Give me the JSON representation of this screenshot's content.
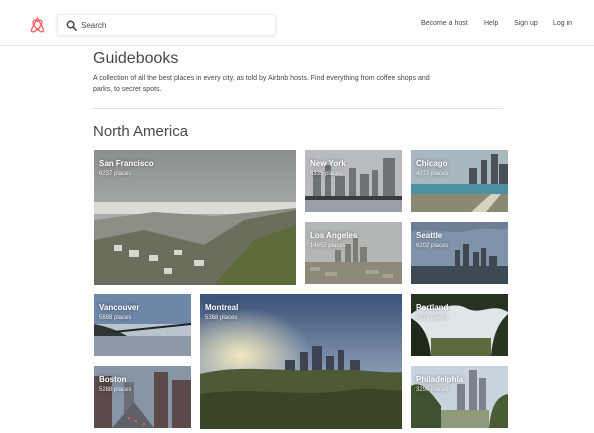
{
  "header": {
    "logo_icon": "airbnb-logo-icon",
    "brand_color": "#ff5a5f",
    "search_icon": "search-icon",
    "search_placeholder": "Search",
    "nav": {
      "become_host": "Become a host",
      "help": "Help",
      "sign_up": "Sign up",
      "log_in": "Log in"
    }
  },
  "page": {
    "title": "Guidebooks",
    "description": "A collection of all the best places in every city, as told by Airbnb hosts. Find everything from coffee shops and parks, to secret spots."
  },
  "section": {
    "title": "North America",
    "cities": [
      {
        "name": "San Francisco",
        "places": "6237 places"
      },
      {
        "name": "New York",
        "places": "5335 places"
      },
      {
        "name": "Chicago",
        "places": "4372 places"
      },
      {
        "name": "Los Angeles",
        "places": "14652 places"
      },
      {
        "name": "Seattle",
        "places": "6202 places"
      },
      {
        "name": "Vancouver",
        "places": "5698 places"
      },
      {
        "name": "Montreal",
        "places": "5368 places"
      },
      {
        "name": "Portland",
        "places": "4975 places"
      },
      {
        "name": "Boston",
        "places": "5288 places"
      },
      {
        "name": "Philadelphia",
        "places": "3296 places"
      }
    ]
  }
}
